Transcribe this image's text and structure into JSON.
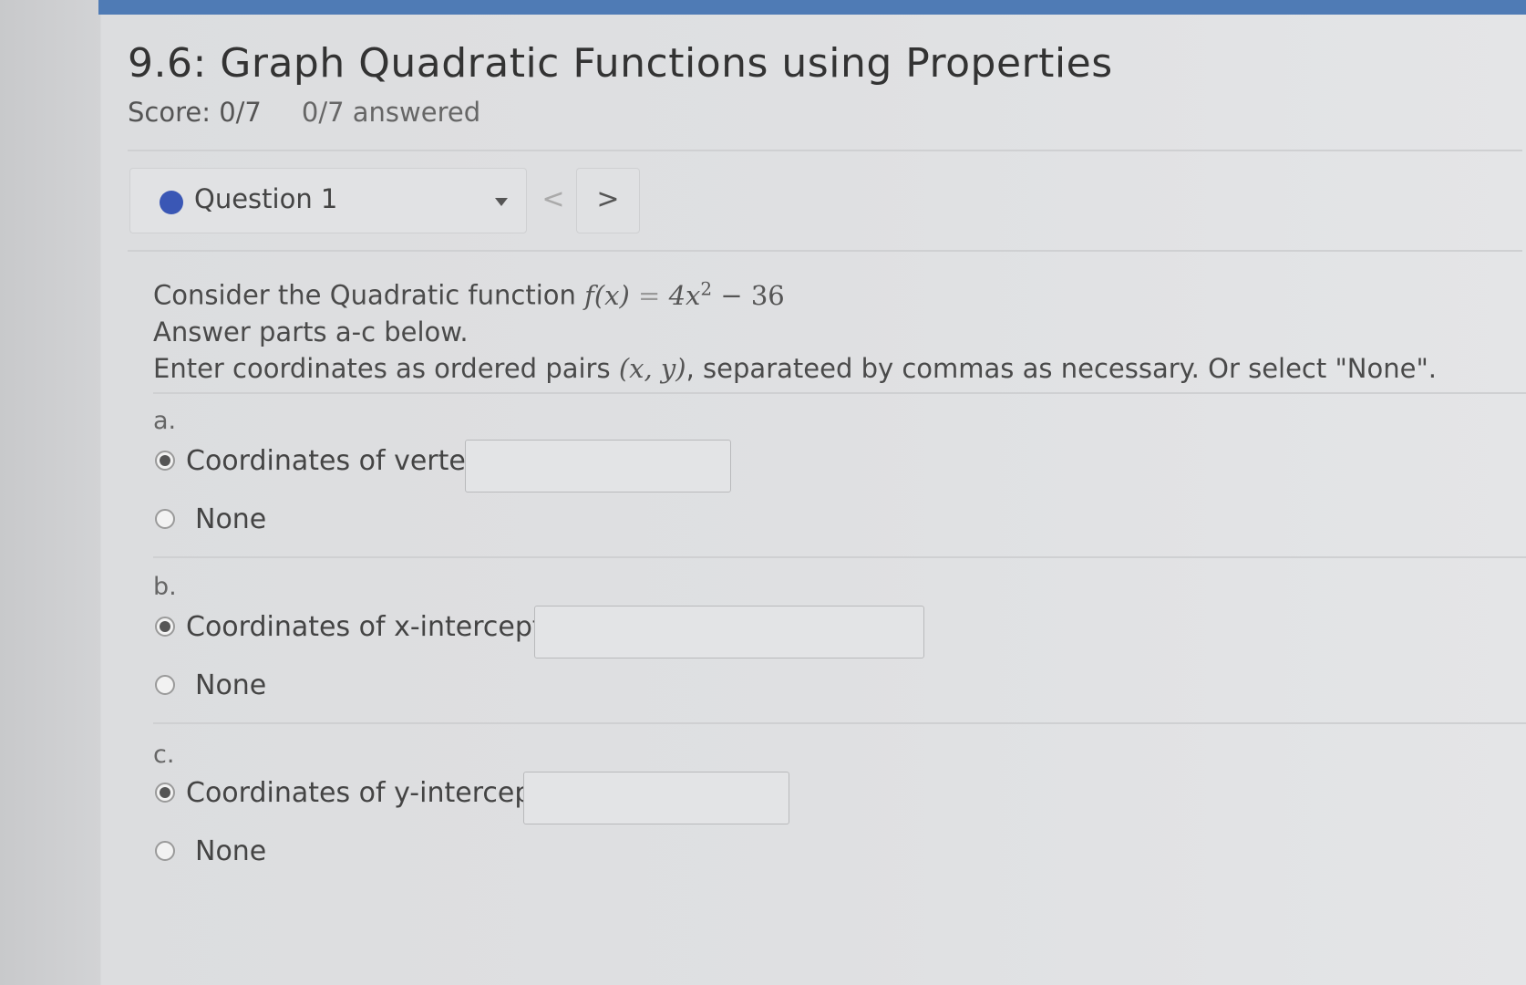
{
  "page": {
    "title": "9.6: Graph Quadratic Functions using Properties",
    "score": "Score: 0/7",
    "answered": "0/7 answered"
  },
  "nav": {
    "question_label": "Question 1",
    "prev_symbol": "<",
    "next_symbol": ">"
  },
  "problem": {
    "intro": "Consider the Quadratic function",
    "function_lhs": "f(x)",
    "function_eq": "=",
    "function_rhs_coef": "4x",
    "function_rhs_exp": "2",
    "function_rhs_const": "− 36",
    "line2": "Answer parts a-c below.",
    "line3_pre": "Enter coordinates as ordered pairs",
    "line3_pair": "(x, y)",
    "line3_post": ", separateed by commas as necessary. Or select \"None\"."
  },
  "parts": [
    {
      "letter": "a.",
      "option_label": "Coordinates of vertex:",
      "none_label": "None",
      "value": "",
      "selected": "coordinates"
    },
    {
      "letter": "b.",
      "option_label": "Coordinates of x-intercepts:",
      "none_label": "None",
      "value": "",
      "selected": "coordinates"
    },
    {
      "letter": "c.",
      "option_label": "Coordinates of y-intercept:",
      "none_label": "None",
      "value": "",
      "selected": "coordinates"
    }
  ],
  "colors": {
    "top_bar": "#4f7bb5",
    "question_dot": "#3a57b5"
  }
}
